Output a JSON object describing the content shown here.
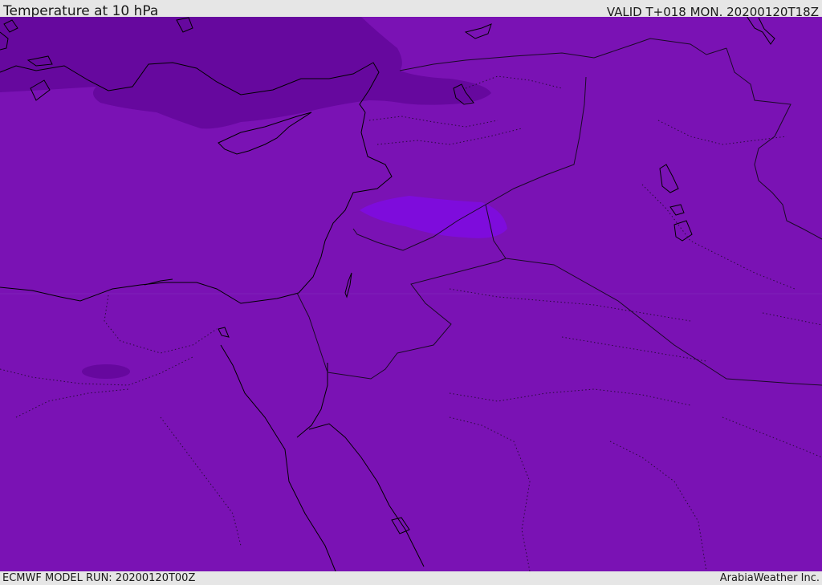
{
  "header": {
    "title": "Temperature at 10 hPa",
    "valid_time": "VALID T+018 MON. 20200120T18Z"
  },
  "footer": {
    "model_run": "ECMWF MODEL RUN: 20200120T00Z",
    "credit": "ArabiaWeather Inc."
  },
  "map": {
    "colors": {
      "background_fill": "#7a12b4",
      "cold_fill": "#66089e",
      "warm_fill": "#7e0cdc",
      "coastline": "#000000",
      "border": "#1a0a26"
    }
  }
}
